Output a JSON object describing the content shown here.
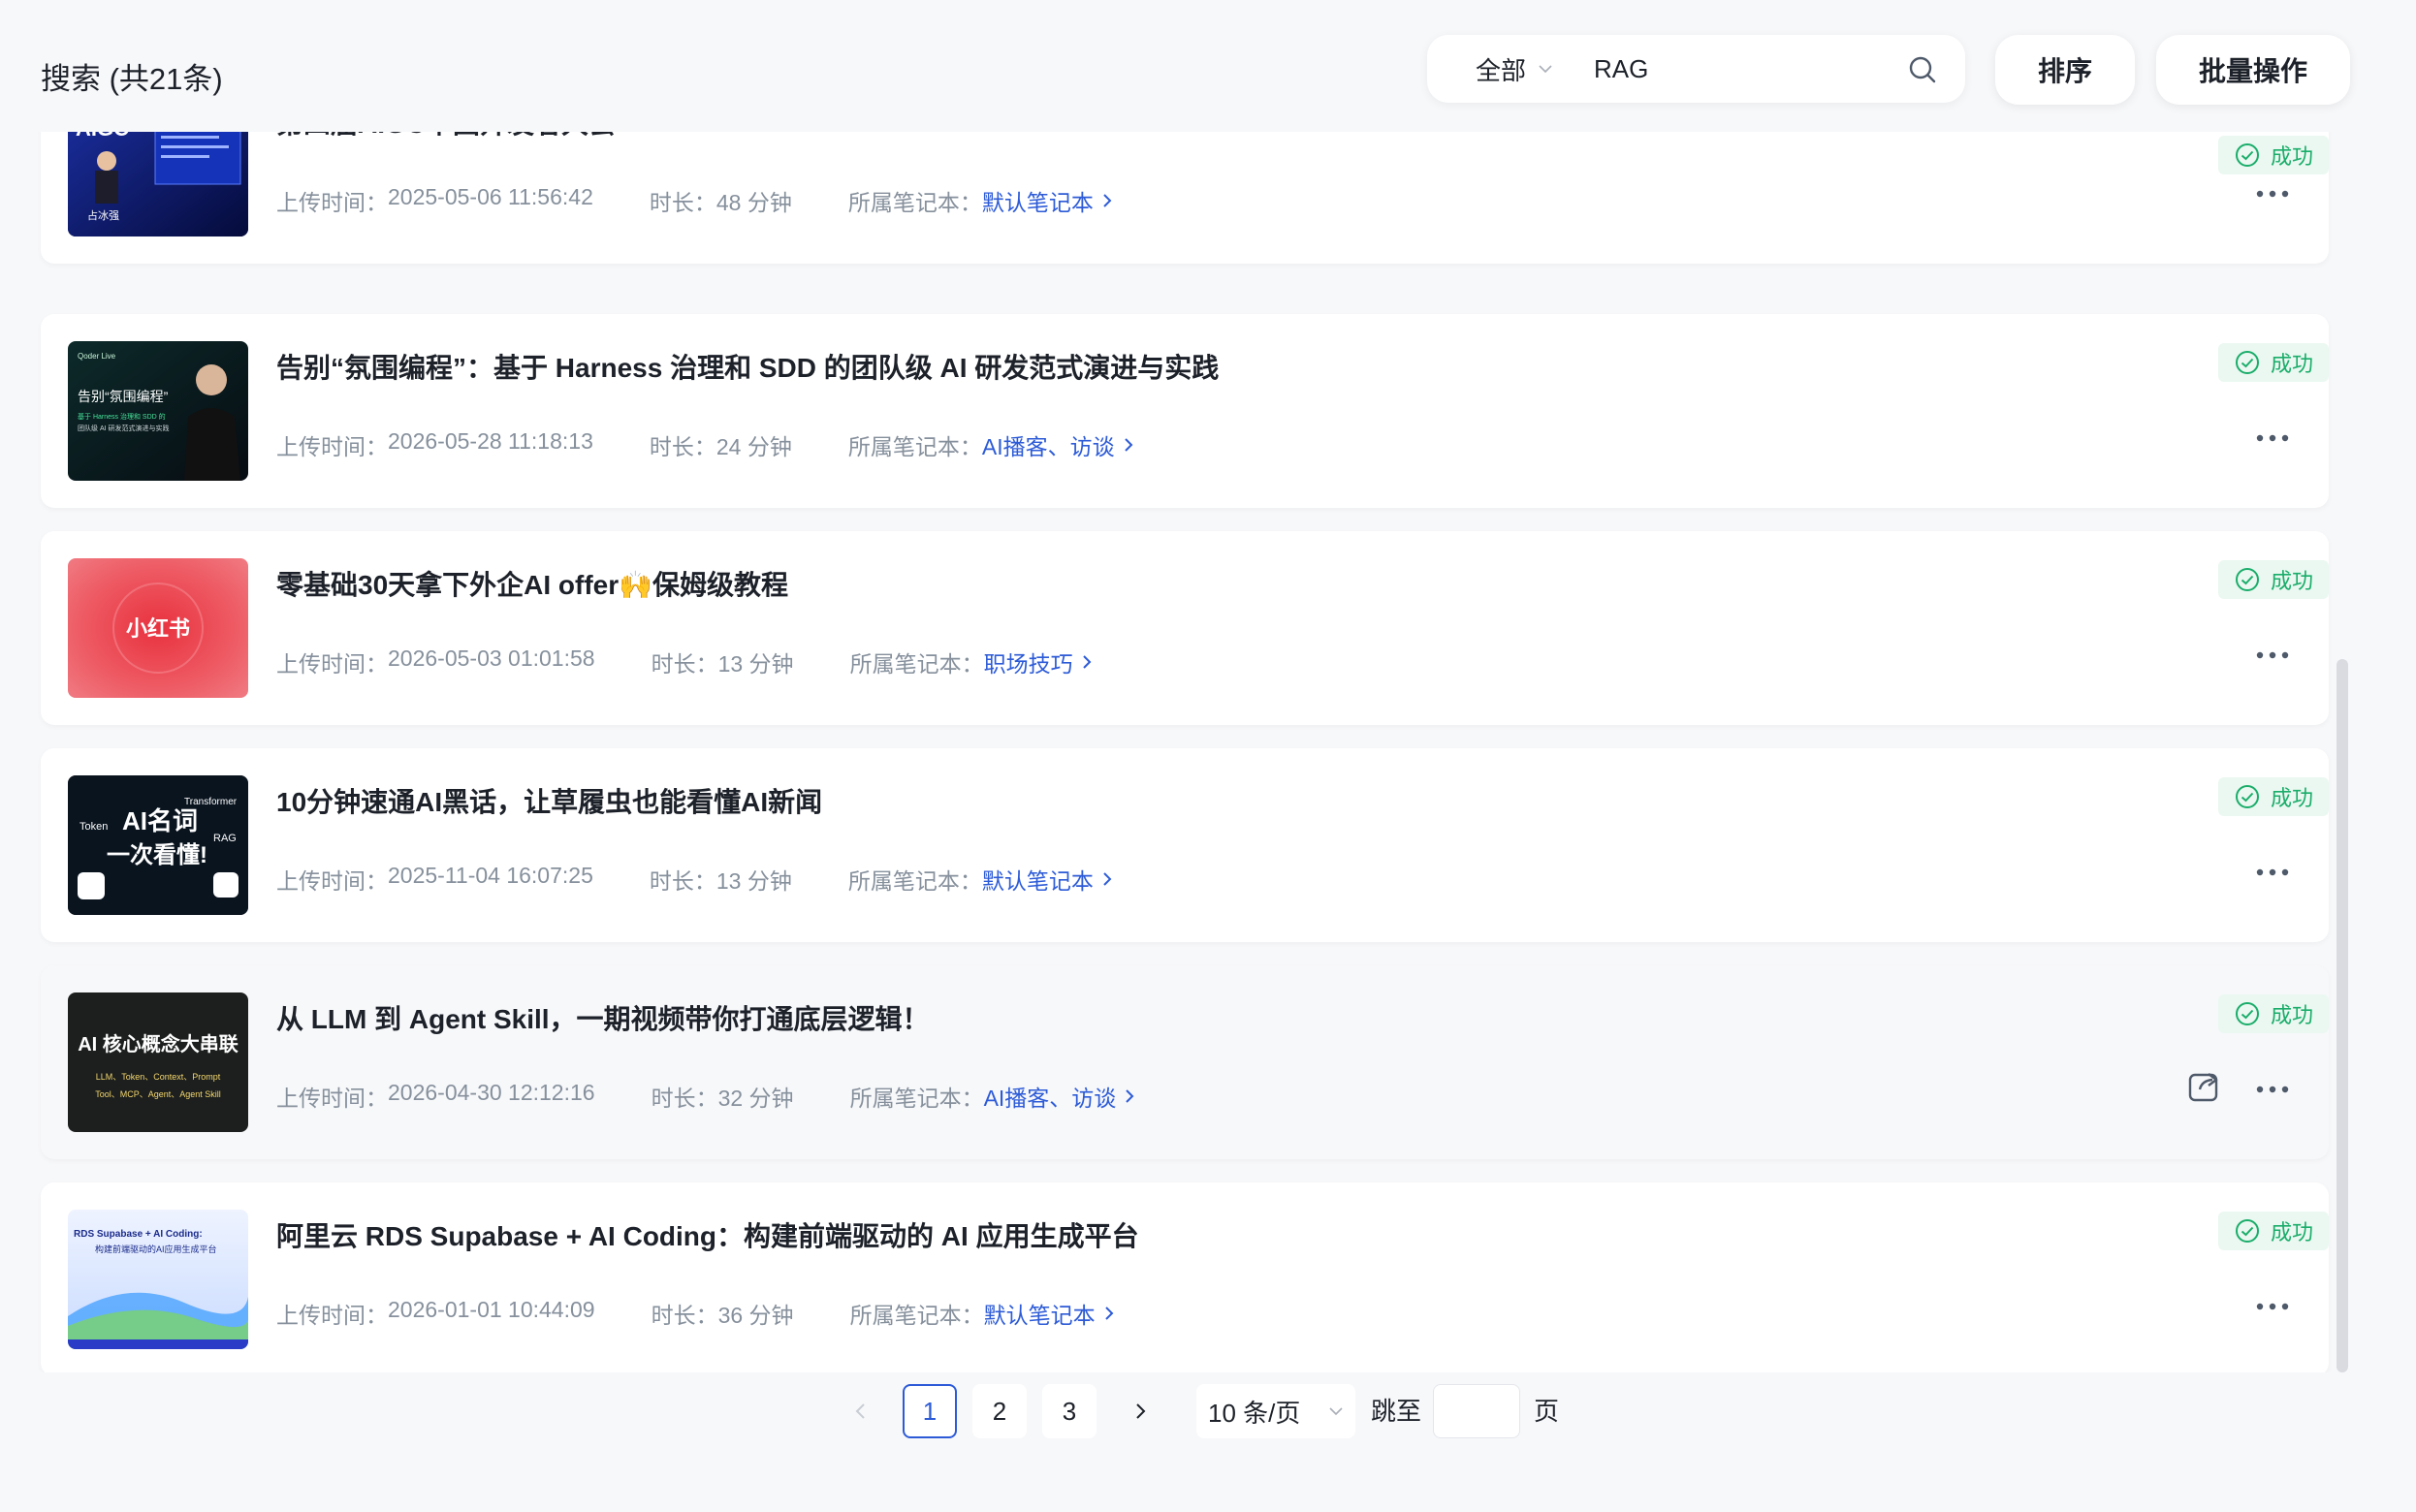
{
  "header": {
    "title": "搜索 (共21条)",
    "scope": "全部",
    "search_value": "RAG",
    "sort_label": "排序",
    "batch_label": "批量操作"
  },
  "labels": {
    "upload": "上传时间：",
    "duration": "时长：",
    "notebook": "所属笔记本："
  },
  "items": [
    {
      "title": "第四届AIGC中国开发者大会",
      "upload_time": "2025-05-06 11:56:42",
      "duration": "48 分钟",
      "notebook": "默认笔记本",
      "status": "成功",
      "thumb_text": [
        "AIGC",
        "占冰强"
      ]
    },
    {
      "title": "告别“氛围编程”：基于 Harness 治理和 SDD 的团队级 AI 研发范式演进与实践",
      "upload_time": "2026-05-28 11:18:13",
      "duration": "24 分钟",
      "notebook": "AI播客、访谈",
      "status": "成功",
      "thumb_text": [
        "Qoder Live",
        "告别“氛围编程”",
        "基于 Harness 治理和 SDD 的",
        "团队级 AI 研发范式演进与实践"
      ]
    },
    {
      "title": "零基础30天拿下外企AI offer🙌保姆级教程",
      "upload_time": "2026-05-03 01:01:58",
      "duration": "13 分钟",
      "notebook": "职场技巧",
      "status": "成功",
      "thumb_text": [
        "小红书"
      ]
    },
    {
      "title": "10分钟速通AI黑话，让草履虫也能看懂AI新闻",
      "upload_time": "2025-11-04 16:07:25",
      "duration": "13 分钟",
      "notebook": "默认笔记本",
      "status": "成功",
      "thumb_text": [
        "AI名词",
        "一次看懂!",
        "Token",
        "RAG",
        "Transformer"
      ]
    },
    {
      "title": "从 LLM 到 Agent Skill，一期视频带你打通底层逻辑！",
      "upload_time": "2026-04-30 12:12:16",
      "duration": "32 分钟",
      "notebook": "AI播客、访谈",
      "status": "成功",
      "thumb_text": [
        "AI 核心概念大串联",
        "LLM、Token、Context、Prompt",
        "Tool、MCP、Agent、Agent Skill"
      ]
    },
    {
      "title": "阿里云 RDS Supabase + AI Coding：构建前端驱动的 AI 应用生成平台",
      "upload_time": "2026-01-01 10:44:09",
      "duration": "36 分钟",
      "notebook": "默认笔记本",
      "status": "成功",
      "thumb_text": [
        "RDS Supabase + AI Coding:",
        "构建前端驱动的AI应用生成平台"
      ]
    }
  ],
  "pagination": {
    "pages": [
      "1",
      "2",
      "3"
    ],
    "active": "1",
    "page_size": "10 条/页",
    "jump_label": "跳至",
    "page_label": "页"
  },
  "colors": {
    "accent": "#2d5bd7",
    "success": "#1aad6a",
    "success_bg": "#ebf8f1",
    "meta": "#86909c"
  }
}
